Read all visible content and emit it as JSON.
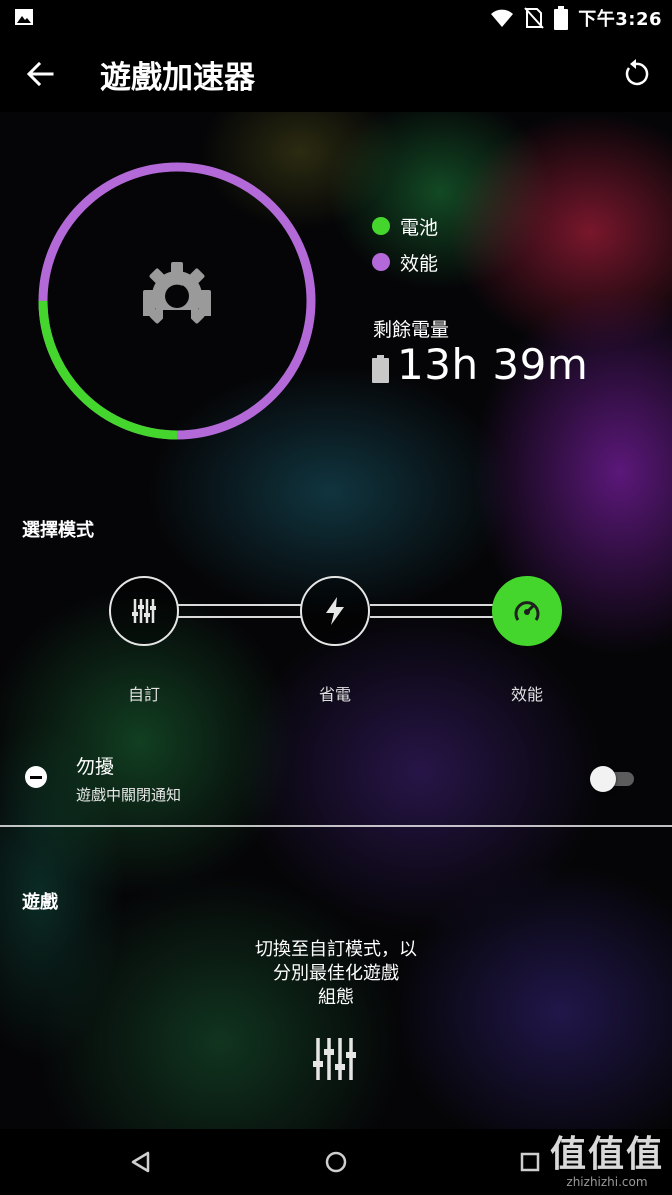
{
  "status_bar": {
    "time": "下午3:26"
  },
  "header": {
    "title": "遊戲加速器"
  },
  "power_ring": {
    "battery_fraction": 0.25,
    "performance_fraction": 0.75,
    "battery_color": "#44d62c",
    "performance_color": "#b36ad8"
  },
  "legend": [
    {
      "label": "電池",
      "color": "#44d62c"
    },
    {
      "label": "效能",
      "color": "#b36ad8"
    }
  ],
  "remaining": {
    "label": "剩餘電量",
    "value": "13h 39m"
  },
  "mode_section": {
    "title": "選擇模式",
    "modes": [
      {
        "label": "自訂",
        "icon": "sliders-icon",
        "selected": false
      },
      {
        "label": "省電",
        "icon": "bolt-icon",
        "selected": false
      },
      {
        "label": "效能",
        "icon": "speedometer-icon",
        "selected": true
      }
    ]
  },
  "dnd": {
    "title": "勿擾",
    "subtitle": "遊戲中關閉通知",
    "enabled": false
  },
  "games": {
    "title": "遊戲",
    "description": "切換至自訂模式，以\n分別最佳化遊戲\n組態"
  },
  "watermark": {
    "logo": "值值值",
    "url": "zhizhizhi.com"
  },
  "colors": {
    "accent": "#44d62c",
    "performance": "#b36ad8"
  }
}
